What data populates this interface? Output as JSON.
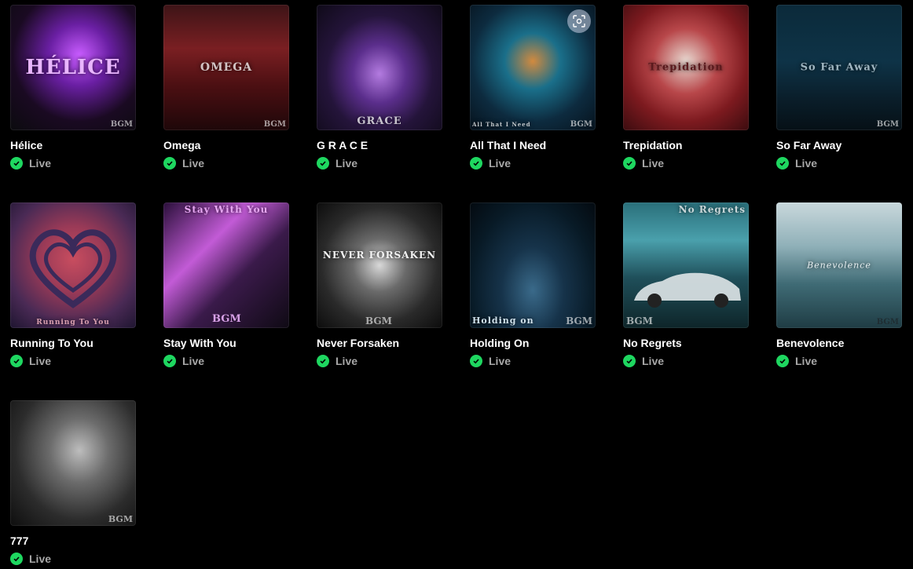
{
  "status_label": "Live",
  "brand_mark": "BGM",
  "albums": [
    {
      "title": "Hélice",
      "art_text": "HÉLICE",
      "art_icon": "helice-cover"
    },
    {
      "title": "Omega",
      "art_text": "OMEGA",
      "art_icon": "omega-cover"
    },
    {
      "title": "G R A C E",
      "art_text": "GRACE",
      "art_icon": "grace-cover"
    },
    {
      "title": "All That I Need",
      "art_text": "All That I Need",
      "art_icon": "all-that-i-need-cover"
    },
    {
      "title": "Trepidation",
      "art_text": "Trepidation",
      "art_icon": "trepidation-cover"
    },
    {
      "title": "So Far Away",
      "art_text": "So Far Away",
      "art_icon": "so-far-away-cover"
    },
    {
      "title": "Running To You",
      "art_text": "Running To You",
      "art_icon": "running-to-you-cover"
    },
    {
      "title": "Stay With You",
      "art_text": "Stay With You",
      "art_icon": "stay-with-you-cover"
    },
    {
      "title": "Never Forsaken",
      "art_text": "NEVER FORSAKEN",
      "art_icon": "never-forsaken-cover"
    },
    {
      "title": "Holding On",
      "art_text": "Holding on",
      "art_icon": "holding-on-cover"
    },
    {
      "title": "No Regrets",
      "art_text": "No Regrets",
      "art_icon": "no-regrets-cover"
    },
    {
      "title": "Benevolence",
      "art_text": "Benevolence",
      "art_icon": "benevolence-cover"
    },
    {
      "title": "777",
      "art_text": "",
      "art_icon": "777-cover"
    }
  ],
  "colors": {
    "background": "#000000",
    "title": "#ffffff",
    "status_text": "#a7a7a7",
    "live_check": "#1ed760"
  }
}
